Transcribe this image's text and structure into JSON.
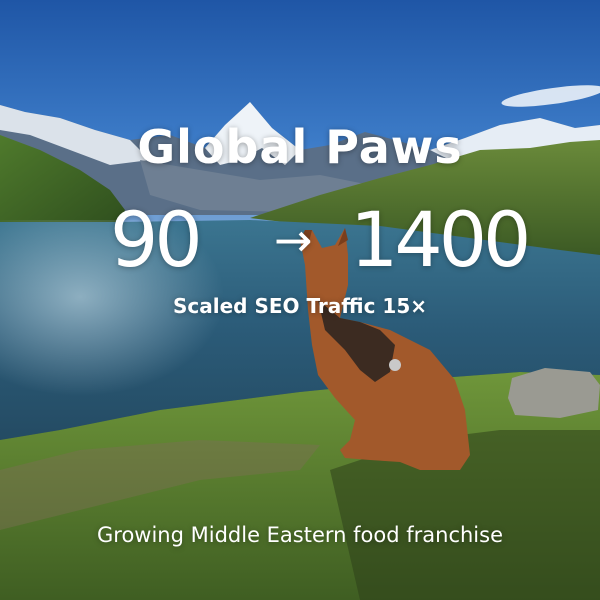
{
  "brand": {
    "title": "Global Paws"
  },
  "metric": {
    "from": "90",
    "arrow": "→",
    "to": "1400",
    "caption": "Scaled SEO Traffic 15×"
  },
  "description": "Growing Middle Eastern food franchise",
  "colors": {
    "text": "#ffffff",
    "sky": "#2c64b0",
    "lake": "#2b5d7c",
    "grass": "#5f8a2f",
    "dog": "#a0582a"
  }
}
